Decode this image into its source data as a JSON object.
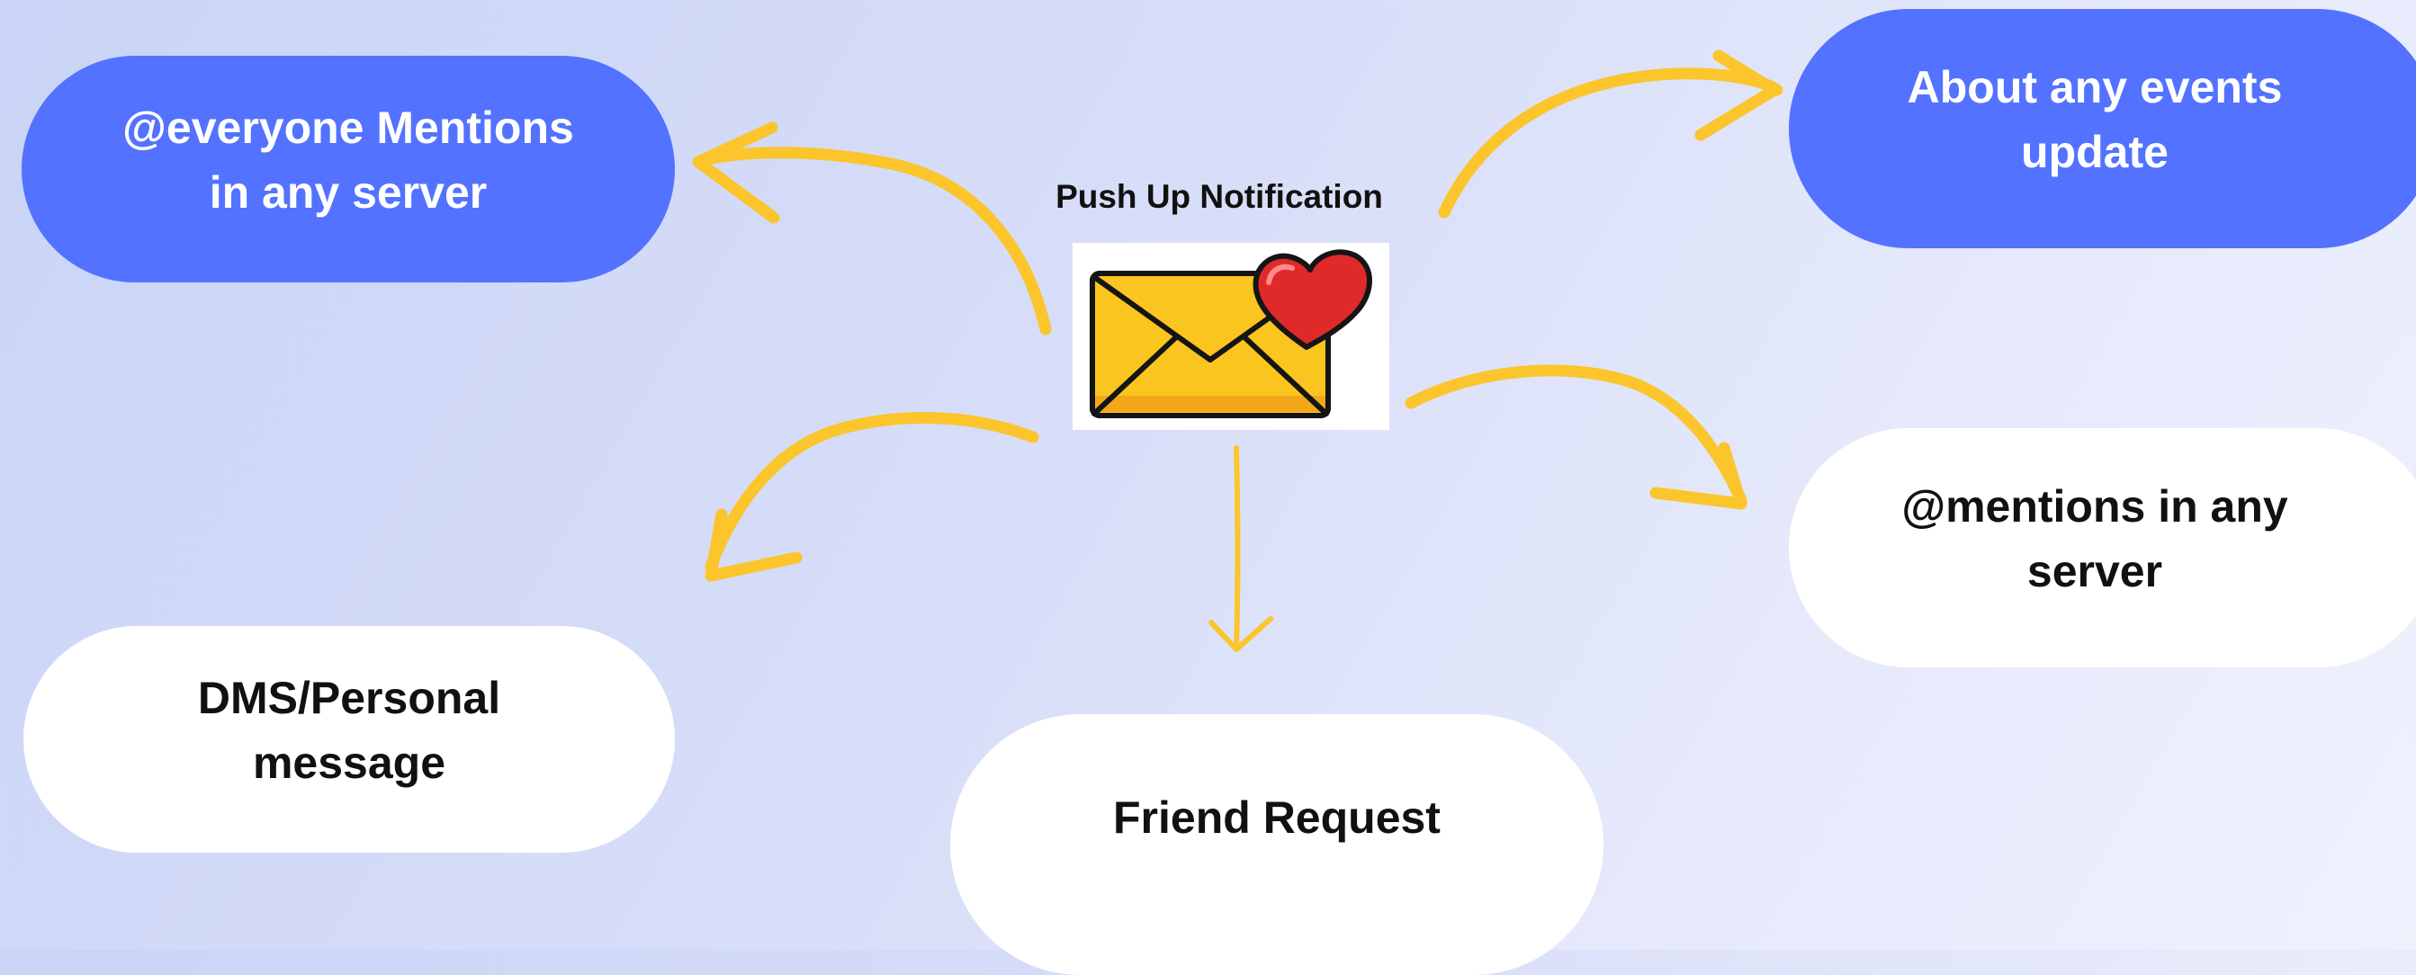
{
  "diagram": {
    "center": {
      "title": "Push Up Notification",
      "icon": "envelope-heart-icon"
    },
    "nodes": {
      "everyone": {
        "line1": "@everyone Mentions",
        "line2": "in any server"
      },
      "events": {
        "line1": "About any events",
        "line2": "update"
      },
      "mentions": {
        "line1": "@mentions in any",
        "line2": "server"
      },
      "dms": {
        "line1": "DMS/Personal",
        "line2": "message"
      },
      "friend": {
        "line1": "Friend Request"
      }
    },
    "colors": {
      "accent_blue": "#5372ff",
      "arrow_yellow": "#fbc52b",
      "envelope_yellow": "#fbc51f",
      "heart_red": "#e02a2a"
    }
  }
}
